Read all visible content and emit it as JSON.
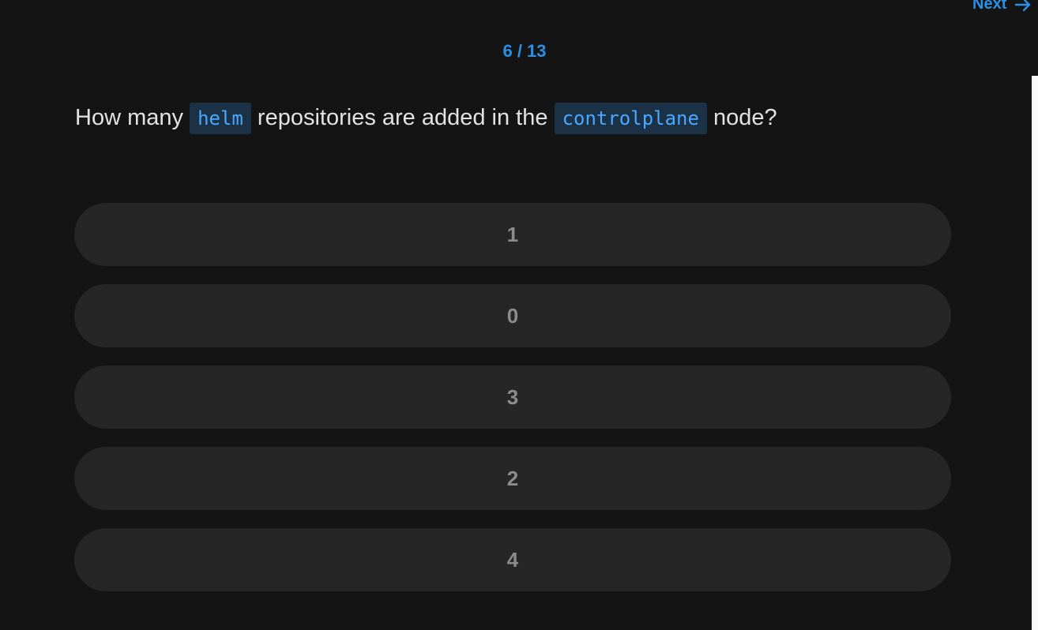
{
  "nav": {
    "next_label": "Next",
    "next_icon": "arrow-right-icon"
  },
  "counter": {
    "text": "6 / 13"
  },
  "question": {
    "part1": "How many",
    "code1": "helm",
    "part2": "repositories are added in the",
    "code2": "controlplane",
    "part3": "node?"
  },
  "options": [
    {
      "label": "1"
    },
    {
      "label": "0"
    },
    {
      "label": "3"
    },
    {
      "label": "2"
    },
    {
      "label": "4"
    }
  ],
  "colors": {
    "accent": "#2b8fe6",
    "background": "#141414",
    "option_bg": "#262626",
    "code_bg": "#1b3146"
  }
}
